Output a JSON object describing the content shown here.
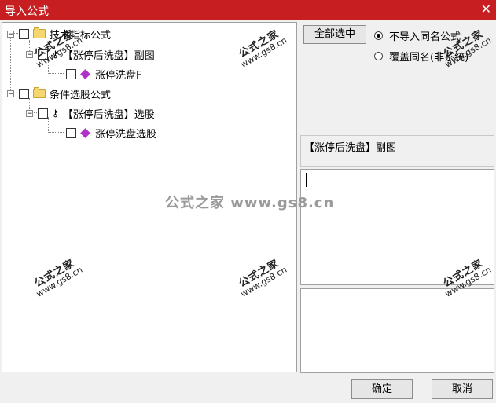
{
  "window": {
    "title": "导入公式"
  },
  "tree": {
    "nodes": [
      {
        "label": "技术指标公式",
        "kind": "folder"
      },
      {
        "label": "【涨停后洗盘】副图",
        "kind": "formula"
      },
      {
        "label": "涨停洗盘F",
        "kind": "item"
      },
      {
        "label": "条件选股公式",
        "kind": "folder"
      },
      {
        "label": "【涨停后洗盘】选股",
        "kind": "formula"
      },
      {
        "label": "涨停洗盘选股",
        "kind": "item"
      }
    ]
  },
  "options": {
    "select_all_label": "全部选中",
    "radio_skip_label": "不导入同名公式",
    "radio_overwrite_label": "覆盖同名(非系统)",
    "selected": "skip"
  },
  "detail": {
    "formula_name": "【涨停后洗盘】副图"
  },
  "buttons": {
    "ok_label": "确定",
    "cancel_label": "取消"
  },
  "watermark": {
    "main": "公式之家",
    "url": "www.gs8.cn",
    "center": "公式之家 www.gs8.cn"
  },
  "colors": {
    "titlebar": "#c71f21",
    "gem": "#b030c9",
    "folder": "#f4d76e"
  }
}
